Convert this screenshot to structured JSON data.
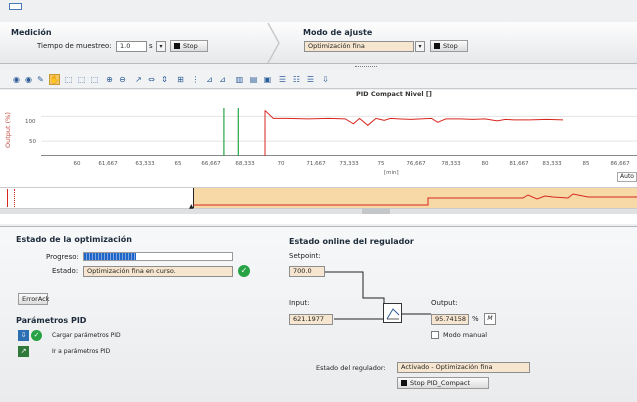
{
  "medicion": {
    "title": "Medición",
    "tiempo_label": "Tiempo de muestreo:",
    "tiempo_value": "1.0",
    "tiempo_unit": "s",
    "stop_label": "Stop"
  },
  "ajuste": {
    "title": "Modo de ajuste",
    "mode_value": "Optimización fina",
    "stop_label": "Stop"
  },
  "chart": {
    "title": "PID Compact Nivel []",
    "ylabel": "Output (%)",
    "xunit": "[min]",
    "auto_label": "Auto",
    "yticks": [
      "100",
      "50"
    ],
    "xticks": [
      "60",
      "61,667",
      "63,333",
      "65",
      "66,667",
      "68,333",
      "70",
      "71,667",
      "73,333",
      "75",
      "76,667",
      "78,333",
      "80",
      "81,667",
      "83,333",
      "85",
      "86,667"
    ]
  },
  "chart_data": {
    "type": "line",
    "title": "PID Compact Nivel []",
    "ylabel": "Output (%)",
    "xlabel": "[min]",
    "xlim": [
      58,
      87
    ],
    "ylim": [
      20,
      125
    ],
    "series": [
      {
        "color": "#d7261e",
        "x": [
          68.9,
          69.3,
          70.0,
          71.0,
          72.0,
          72.8,
          73.2,
          73.5,
          73.9,
          74.3,
          74.7,
          75.0,
          75.4,
          76.0,
          77.0,
          77.3,
          77.7,
          78.4,
          79.0,
          79.6,
          80.2,
          80.6,
          81.0,
          81.8,
          82.6,
          83.4
        ],
        "y": [
          112,
          96,
          96,
          95,
          96,
          95,
          85,
          96,
          82,
          96,
          92,
          96,
          95,
          94,
          96,
          88,
          95,
          95,
          94,
          95,
          91,
          94,
          93,
          93,
          94,
          93
        ]
      },
      {
        "color": "#222222",
        "x": [
          68.9,
          68.9
        ],
        "y": [
          82,
          52
        ]
      }
    ],
    "markers_green": [
      66.9,
      67.6
    ]
  },
  "estado_opt": {
    "title": "Estado de la optimización",
    "progreso_label": "Progreso:",
    "estado_label": "Estado:",
    "estado_value": "Optimización fina en curso.",
    "progress": 0.35
  },
  "erroack_label": "ErrorAck",
  "pid_params": {
    "title": "Parámetros PID",
    "cargar_label": "Cargar parámetros PID",
    "ir_label": "Ir a parámetros PID"
  },
  "online": {
    "title": "Estado online del regulador",
    "setpoint_label": "Setpoint:",
    "setpoint_value": "700.0",
    "input_label": "Input:",
    "input_value": "621.1977",
    "output_label": "Output:",
    "output_value": "95.74158",
    "output_unit": "%",
    "modo_manual_label": "Modo manual",
    "estado_regulador_label": "Estado del regulador:",
    "estado_regulador_value": "Activado - Optimización fina",
    "stop_pid_label": "Stop PID_Compact"
  },
  "colors": {
    "accent_blue": "#1f66c8",
    "ok_green": "#27a244",
    "line_red": "#d7261e",
    "band_orange": "#f6d9a6"
  }
}
